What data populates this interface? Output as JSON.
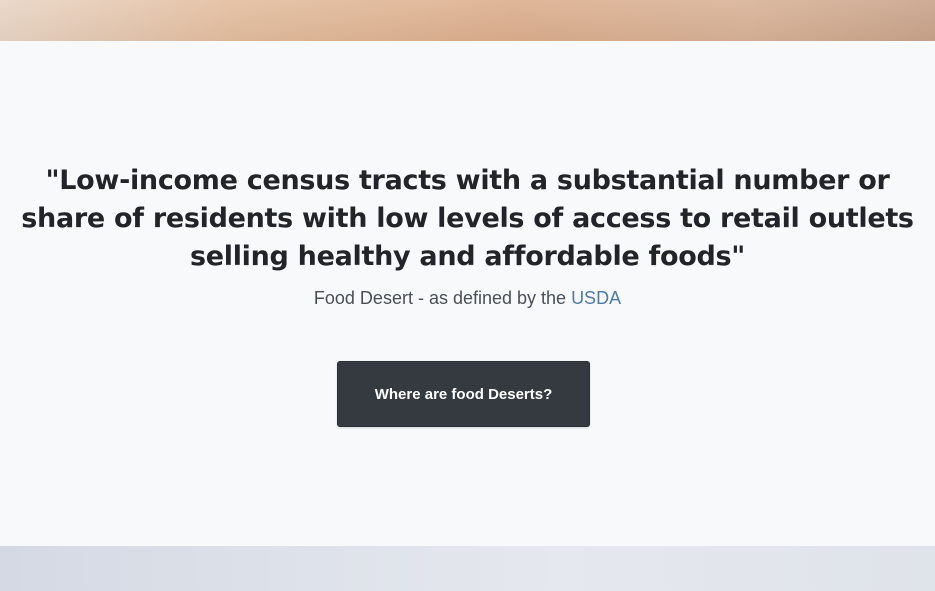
{
  "hero": {
    "quote": "\"Low-income census tracts with a substantial number or share of residents with low levels of access to retail outlets selling healthy and affordable foods\"",
    "caption_text": "Food Desert - as defined by the ",
    "caption_link": "USDA",
    "button_label": "Where are food Deserts?"
  },
  "colors": {
    "button_bg": "#343a40",
    "link": "#4d7ba6",
    "page_bg": "#f8f9fa"
  }
}
